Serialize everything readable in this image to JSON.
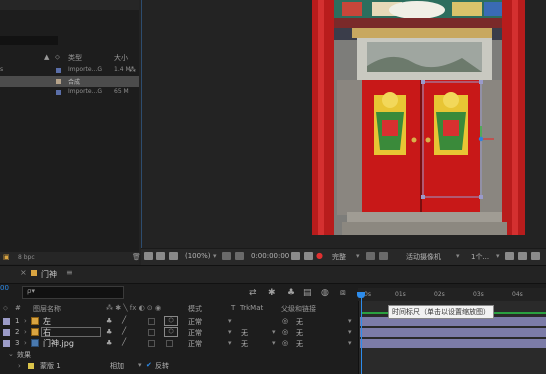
{
  "project": {
    "columns": {
      "type": "类型",
      "size": "大小"
    },
    "items": [
      {
        "label": "s",
        "type": "Importe...G",
        "size": "1.4 M",
        "swatch": "#5a6ea8"
      },
      {
        "label": "",
        "type": "合成",
        "size": "",
        "swatch": "#b6a38a",
        "selected": true
      },
      {
        "label": "",
        "type": "Importe...G",
        "size": "65 M",
        "swatch": "#5a6ea8"
      }
    ],
    "footer": {
      "bpc": "8 bpc"
    }
  },
  "viewer": {
    "zoom": "(100%)",
    "timecode": "0:00:00:00",
    "quality": "完整",
    "camera": "活动摄像机",
    "views": "1个..."
  },
  "timeline": {
    "comp_tab": "门神",
    "current_time": "00",
    "search_glyph": "ρ▾",
    "headers": {
      "layer_name": "图层名称",
      "mode": "模式",
      "t": "T",
      "trkmat": "TrkMat",
      "parent": "父级和链接"
    },
    "ruler": [
      "0s",
      "01s",
      "02s",
      "03s",
      "04s"
    ],
    "tooltip": "时间标尺（单击以设置缩放图）",
    "layers": [
      {
        "num": "1",
        "name": "左",
        "mode": "正常",
        "trkmat": "",
        "parent": "无",
        "label_color": "#9c9cc8",
        "bar_color": "#7c7ca8"
      },
      {
        "num": "2",
        "name": "右",
        "mode": "正常",
        "trkmat": "无",
        "parent": "无",
        "label_color": "#9c9cc8",
        "bar_color": "#7c7ca8",
        "editing": true
      },
      {
        "num": "3",
        "name": "门神.jpg",
        "mode": "正常",
        "trkmat": "无",
        "parent": "无",
        "label_color": "#9c9cc8",
        "bar_color": "#7c7ca8"
      }
    ],
    "effects_group": "效果",
    "effect": {
      "name": "蒙版 1",
      "mode": "相加",
      "invert_label": "反转"
    }
  }
}
